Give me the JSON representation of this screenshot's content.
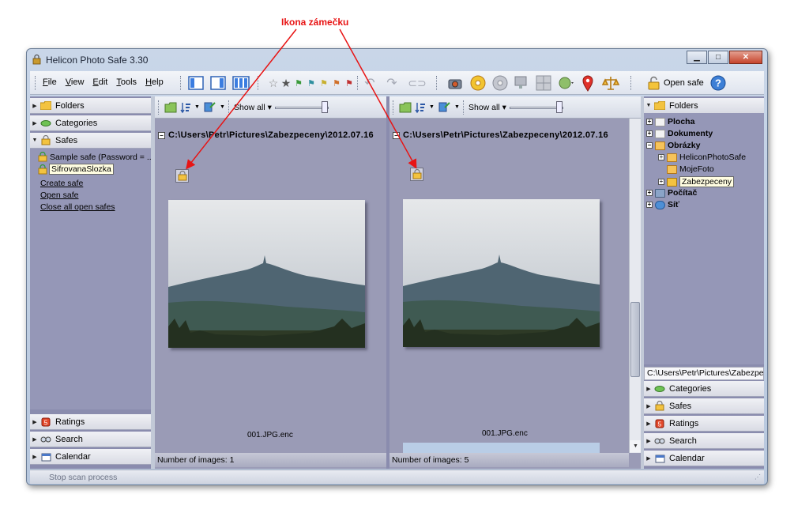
{
  "annotation": {
    "label": "Ikona zámečku",
    "color": "#e81414"
  },
  "window": {
    "title": "Helicon Photo Safe 3.30",
    "min_glyph": "▁",
    "max_glyph": "□",
    "close_glyph": "✕"
  },
  "menu": {
    "file": "File",
    "view": "View",
    "edit": "Edit",
    "tools": "Tools",
    "help": "Help"
  },
  "toolbar": {
    "open_safe_label": "Open safe"
  },
  "left_panel": {
    "folders": "Folders",
    "categories": "Categories",
    "safes": "Safes",
    "safes_items": [
      "Sample safe (Password = ...",
      "SifrovanaSlozka"
    ],
    "links": [
      "Create safe",
      "Open safe",
      "Close all open safes"
    ],
    "ratings": "Ratings",
    "search": "Search",
    "calendar": "Calendar"
  },
  "viewer_left": {
    "show_all": "Show all",
    "path": "C:\\Users\\Petr\\Pictures\\Zabezpeceny\\2012.07.16",
    "filename": "001.JPG.enc",
    "status": "Number of images: 1"
  },
  "viewer_right": {
    "show_all": "Show all",
    "path": "C:\\Users\\Petr\\Pictures\\Zabezpeceny\\2012.07.16",
    "filename": "001.JPG.enc",
    "status": "Number of images: 5"
  },
  "right_panel": {
    "folders": "Folders",
    "tree": [
      "Plocha",
      "Dokumenty",
      "Obrázky",
      "HeliconPhotoSafe",
      "MojeFoto",
      "Zabezpeceny",
      "Počítač",
      "Síť"
    ],
    "path": "C:\\Users\\Petr\\Pictures\\Zabezpec",
    "categories": "Categories",
    "safes": "Safes",
    "ratings": "Ratings",
    "search": "Search",
    "calendar": "Calendar"
  },
  "status_bar": {
    "stop_scan": "Stop scan process"
  }
}
